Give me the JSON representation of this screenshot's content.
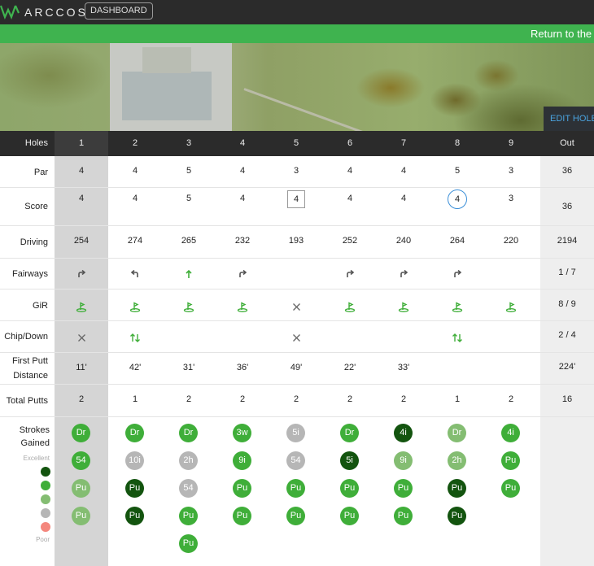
{
  "header": {
    "logo_text": "ARCCOS",
    "dashboard_label": "DASHBOARD"
  },
  "banner": {
    "return_link": "Return to the course"
  },
  "map": {
    "edit_hole_label": "EDIT HOLE"
  },
  "colors": {
    "sg_dark": "#13540f",
    "sg_green": "#3fae39",
    "sg_light": "#84bd72",
    "sg_gray": "#b6b6b6",
    "sg_poor": "#f4877d",
    "accent": "#3fb34f"
  },
  "scorecard": {
    "header_label": "Holes",
    "holes": [
      "1",
      "2",
      "3",
      "4",
      "5",
      "6",
      "7",
      "8",
      "9"
    ],
    "out_label": "Out",
    "rows": [
      {
        "label": "Par",
        "values": [
          "4",
          "4",
          "5",
          "4",
          "3",
          "4",
          "4",
          "5",
          "3"
        ],
        "total": "36"
      },
      {
        "label": "Score",
        "values": [
          "4",
          "4",
          "5",
          "4",
          "4",
          "4",
          "4",
          "4",
          "3"
        ],
        "total": "36",
        "marks": [
          "",
          "",
          "",
          "",
          "bogey",
          "",
          "",
          "birdie",
          ""
        ]
      },
      {
        "label": "Driving",
        "values": [
          "254",
          "274",
          "265",
          "232",
          "193",
          "252",
          "240",
          "264",
          "220"
        ],
        "total": "2194"
      },
      {
        "label": "Fairways",
        "icons": [
          "right-arrow-icon",
          "left-arrow-icon",
          "up-arrow-icon",
          "right-arrow-icon",
          "",
          "right-arrow-icon",
          "right-arrow-icon",
          "right-arrow-icon",
          ""
        ],
        "total": "1 / 7"
      },
      {
        "label": "GiR",
        "icons": [
          "green-flag-icon",
          "green-flag-icon",
          "green-flag-icon",
          "green-flag-icon",
          "miss-x-icon",
          "green-flag-icon",
          "green-flag-icon",
          "green-flag-icon",
          "green-flag-icon"
        ],
        "total": "8 / 9"
      },
      {
        "label": "Chip/Down",
        "icons": [
          "miss-x-icon",
          "updown-icon",
          "",
          "",
          "miss-x-icon",
          "",
          "",
          "updown-icon",
          ""
        ],
        "total": "2 / 4"
      },
      {
        "label_line1": "First Putt",
        "label_line2": "Distance",
        "values": [
          "11'",
          "42'",
          "31'",
          "36'",
          "49'",
          "22'",
          "33'",
          "",
          ""
        ],
        "total": "224'"
      },
      {
        "label": "Total Putts",
        "values": [
          "2",
          "1",
          "2",
          "2",
          "2",
          "2",
          "2",
          "1",
          "2"
        ],
        "total": "16"
      }
    ],
    "strokes_gained": {
      "label_line1": "Strokes",
      "label_line2": "Gained",
      "legend_top": "Excellent",
      "legend_bottom": "Poor",
      "holes": [
        [
          {
            "c": "Dr",
            "r": "good"
          },
          {
            "c": "54",
            "r": "good"
          },
          {
            "c": "Pu",
            "r": "ok"
          },
          {
            "c": "Pu",
            "r": "ok"
          }
        ],
        [
          {
            "c": "Dr",
            "r": "good"
          },
          {
            "c": "10i",
            "r": "neutral"
          },
          {
            "c": "Pu",
            "r": "excellent"
          },
          {
            "c": "Pu",
            "r": "excellent"
          }
        ],
        [
          {
            "c": "Dr",
            "r": "good"
          },
          {
            "c": "2h",
            "r": "neutral"
          },
          {
            "c": "54",
            "r": "neutral"
          },
          {
            "c": "Pu",
            "r": "good"
          },
          {
            "c": "Pu",
            "r": "good"
          }
        ],
        [
          {
            "c": "3w",
            "r": "good"
          },
          {
            "c": "9i",
            "r": "good"
          },
          {
            "c": "Pu",
            "r": "good"
          },
          {
            "c": "Pu",
            "r": "good"
          }
        ],
        [
          {
            "c": "5i",
            "r": "neutral"
          },
          {
            "c": "54",
            "r": "neutral"
          },
          {
            "c": "Pu",
            "r": "good"
          },
          {
            "c": "Pu",
            "r": "good"
          }
        ],
        [
          {
            "c": "Dr",
            "r": "good"
          },
          {
            "c": "5i",
            "r": "excellent"
          },
          {
            "c": "Pu",
            "r": "good"
          },
          {
            "c": "Pu",
            "r": "good"
          }
        ],
        [
          {
            "c": "4i",
            "r": "excellent"
          },
          {
            "c": "9i",
            "r": "ok"
          },
          {
            "c": "Pu",
            "r": "good"
          },
          {
            "c": "Pu",
            "r": "good"
          }
        ],
        [
          {
            "c": "Dr",
            "r": "ok"
          },
          {
            "c": "2h",
            "r": "ok"
          },
          {
            "c": "Pu",
            "r": "excellent"
          },
          {
            "c": "Pu",
            "r": "excellent"
          }
        ],
        [
          {
            "c": "4i",
            "r": "good"
          },
          {
            "c": "Pu",
            "r": "good"
          },
          {
            "c": "Pu",
            "r": "good"
          }
        ]
      ]
    }
  }
}
